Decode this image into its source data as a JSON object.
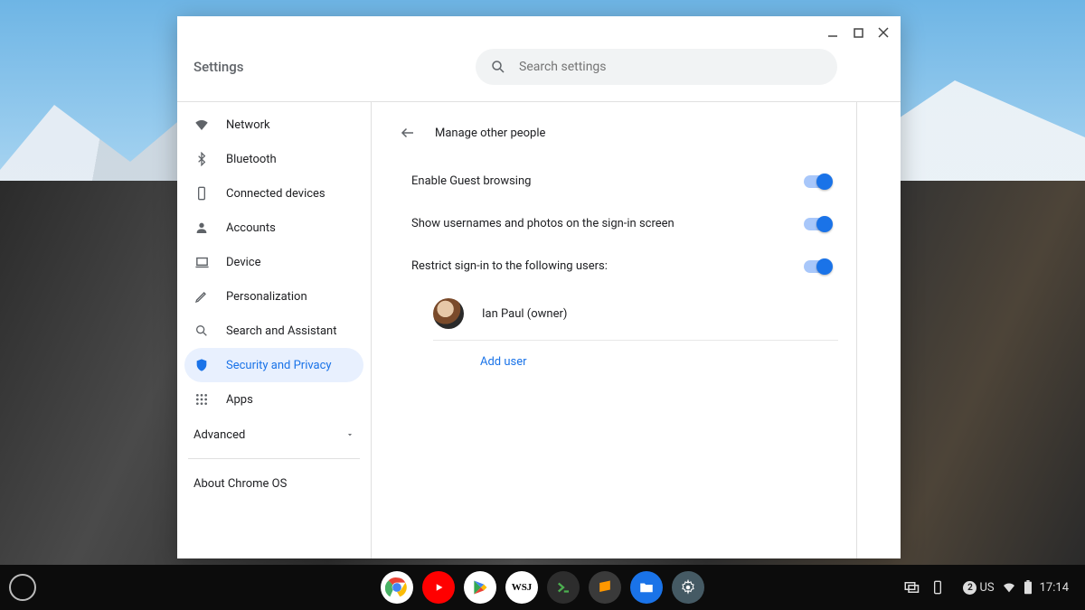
{
  "app": {
    "title": "Settings"
  },
  "search": {
    "placeholder": "Search settings"
  },
  "sidebar": {
    "items": [
      {
        "label": "Network"
      },
      {
        "label": "Bluetooth"
      },
      {
        "label": "Connected devices"
      },
      {
        "label": "Accounts"
      },
      {
        "label": "Device"
      },
      {
        "label": "Personalization"
      },
      {
        "label": "Search and Assistant"
      },
      {
        "label": "Security and Privacy"
      },
      {
        "label": "Apps"
      }
    ],
    "advanced": "Advanced",
    "about": "About Chrome OS"
  },
  "page": {
    "title": "Manage other people",
    "rows": [
      {
        "label": "Enable Guest browsing",
        "on": true
      },
      {
        "label": "Show usernames and photos on the sign-in screen",
        "on": true
      },
      {
        "label": "Restrict sign-in to the following users:",
        "on": true
      }
    ],
    "user": "Ian Paul (owner)",
    "add_user": "Add user"
  },
  "tray": {
    "notif_count": "2",
    "ime": "US",
    "time": "17:14"
  }
}
